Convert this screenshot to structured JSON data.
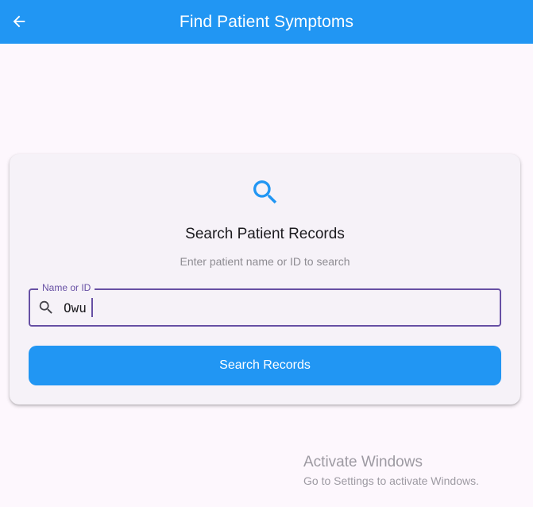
{
  "appbar": {
    "title": "Find Patient Symptoms",
    "back_icon": "arrow-left-icon",
    "color": "#2196f3"
  },
  "card": {
    "icon": "search-icon",
    "title": "Search Patient Records",
    "subtitle": "Enter patient name or ID to search",
    "field": {
      "label": "Name or ID",
      "value": "Owu",
      "icon": "search-icon"
    },
    "button_label": "Search Records"
  },
  "watermark": {
    "title": "Activate Windows",
    "subtitle": "Go to Settings to activate Windows."
  }
}
